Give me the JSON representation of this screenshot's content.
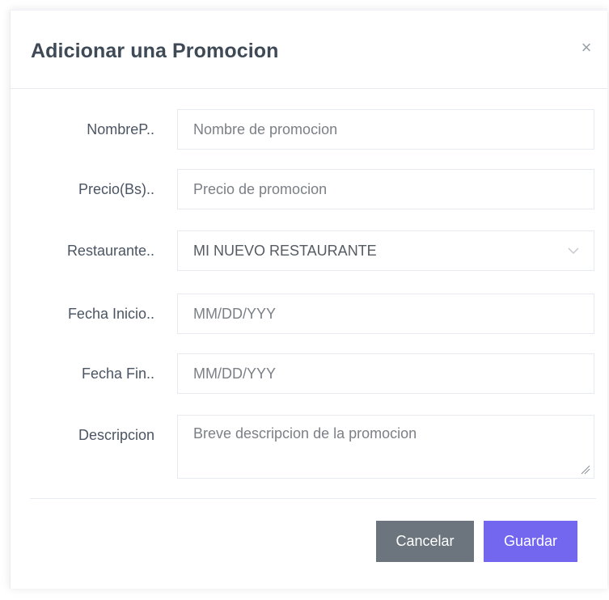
{
  "modal": {
    "title": "Adicionar una Promocion",
    "close_label": "×"
  },
  "form": {
    "fields": [
      {
        "label": "NombreP..",
        "placeholder": "Nombre de promocion"
      },
      {
        "label": "Precio(Bs)..",
        "placeholder": "Precio de promocion"
      },
      {
        "label": "Restaurante..",
        "value": "MI NUEVO RESTAURANTE",
        "icon": "chevron-down-icon"
      },
      {
        "label": "Fecha Inicio..",
        "placeholder": "MM/DD/YYY"
      },
      {
        "label": "Fecha Fin..",
        "placeholder": "MM/DD/YYY"
      },
      {
        "label": "Descripcion",
        "placeholder": "Breve descripcion de la promocion",
        "icon": "resize-grip-icon"
      }
    ]
  },
  "footer": {
    "cancel_label": "Cancelar",
    "save_label": "Guardar"
  },
  "colors": {
    "accent": "#7367f0",
    "secondary": "#6c757d",
    "title_text": "#3f4a57"
  }
}
